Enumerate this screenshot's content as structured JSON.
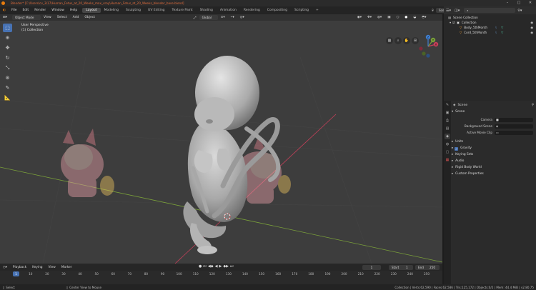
{
  "window": {
    "title": "Blender* [C:\\Users\\cv_3\\17\\Human_Fetus_at_20_Weeks_max_vray\\Human_Fetus_at_20_Weeks_blender_base.blend]",
    "controls": [
      "–",
      "□",
      "✕"
    ]
  },
  "topbar": {
    "menus": [
      "File",
      "Edit",
      "Render",
      "Window",
      "Help"
    ],
    "workspaces": [
      "Layout",
      "Modeling",
      "Sculpting",
      "UV Editing",
      "Texture Paint",
      "Shading",
      "Animation",
      "Rendering",
      "Compositing",
      "Scripting"
    ],
    "active_workspace": "Layout",
    "add_tab": "+",
    "scene_label": "Scene",
    "view_layer_label": "View Layer"
  },
  "viewport": {
    "mode": "Object Mode",
    "menus": [
      "View",
      "Select",
      "Add",
      "Object"
    ],
    "orientation": "Global",
    "info_line1": "User Perspective",
    "info_line2": "(1) Collection",
    "gizmo": {
      "x": "X",
      "y": "Y",
      "z": "Z"
    },
    "x_axis_color": "#c8405a",
    "y_axis_color": "#7aa03a"
  },
  "timeline": {
    "menus": [
      "Playback",
      "Keying",
      "View",
      "Marker"
    ],
    "current_frame": "1",
    "start_label": "Start",
    "start_value": "1",
    "end_label": "End",
    "end_value": "250",
    "ruler_ticks": [
      "1",
      "10",
      "20",
      "30",
      "40",
      "50",
      "60",
      "70",
      "80",
      "90",
      "100",
      "110",
      "120",
      "130",
      "140",
      "150",
      "160",
      "170",
      "180",
      "190",
      "200",
      "210",
      "220",
      "230",
      "240",
      "250"
    ]
  },
  "outliner": {
    "rows": [
      {
        "label": "Scene Collection"
      },
      {
        "label": "Collection"
      },
      {
        "label": "Body_5thMonth"
      },
      {
        "label": "Cord_5thMonth"
      }
    ]
  },
  "properties": {
    "context_label": "Scene",
    "section_title": "Scene",
    "camera_label": "Camera",
    "background_scene_label": "Background Scene",
    "active_movie_clip_label": "Active Movie Clip",
    "panels": [
      {
        "label": "Units",
        "checkbox": false
      },
      {
        "label": "Gravity",
        "checkbox": true
      },
      {
        "label": "Keying Sets",
        "checkbox": false
      },
      {
        "label": "Audio",
        "checkbox": false
      },
      {
        "label": "Rigid Body World",
        "checkbox": false
      },
      {
        "label": "Custom Properties",
        "checkbox": false
      }
    ]
  },
  "statusbar": {
    "left": "Select",
    "middle": "Center View to Mouse",
    "right": "Collection | Verts:62,590 | Faces:62,586 | Tris:125,172 | Objects:0/2 | Mem: 44.4 MiB | v2.80.75"
  }
}
